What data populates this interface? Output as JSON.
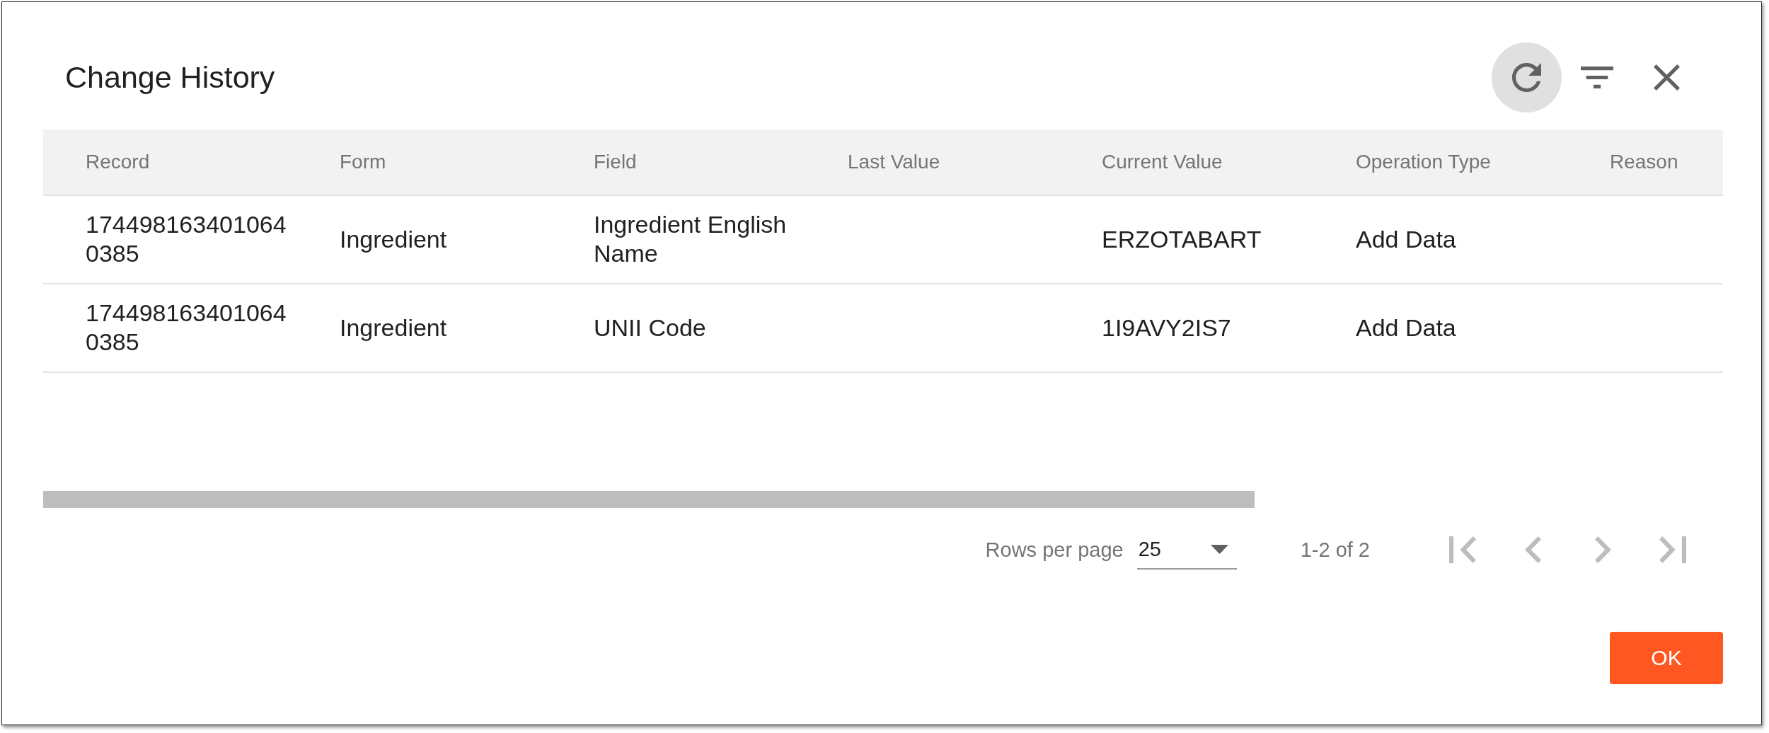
{
  "dialog": {
    "title": "Change History",
    "tools": [
      {
        "kind": "refresh",
        "highlighted": true
      },
      {
        "kind": "filter",
        "highlighted": false
      },
      {
        "kind": "close",
        "highlighted": false
      }
    ]
  },
  "table": {
    "columns": [
      "Record",
      "Form",
      "Field",
      "Last Value",
      "Current Value",
      "Operation Type",
      "Reason"
    ],
    "rows": [
      {
        "record": "1744981634010640385",
        "form": "Ingredient",
        "field": "Ingredient English Name",
        "current_value": "ERZOTABART",
        "operation_type": "Add Data"
      },
      {
        "record": "1744981634010640385",
        "form": "Ingredient",
        "field": "UNII Code",
        "current_value": "1I9AVY2IS7",
        "operation_type": "Add Data"
      }
    ]
  },
  "pagination": {
    "rows_per_page_label": "Rows per page",
    "rows_per_page": "25",
    "range": "1-2 of 2",
    "nav": [
      {
        "kind": "first",
        "disabled": true
      },
      {
        "kind": "previous",
        "disabled": true
      },
      {
        "kind": "next",
        "disabled": true
      },
      {
        "kind": "last",
        "disabled": true
      }
    ]
  },
  "buttons": [
    "OK"
  ]
}
